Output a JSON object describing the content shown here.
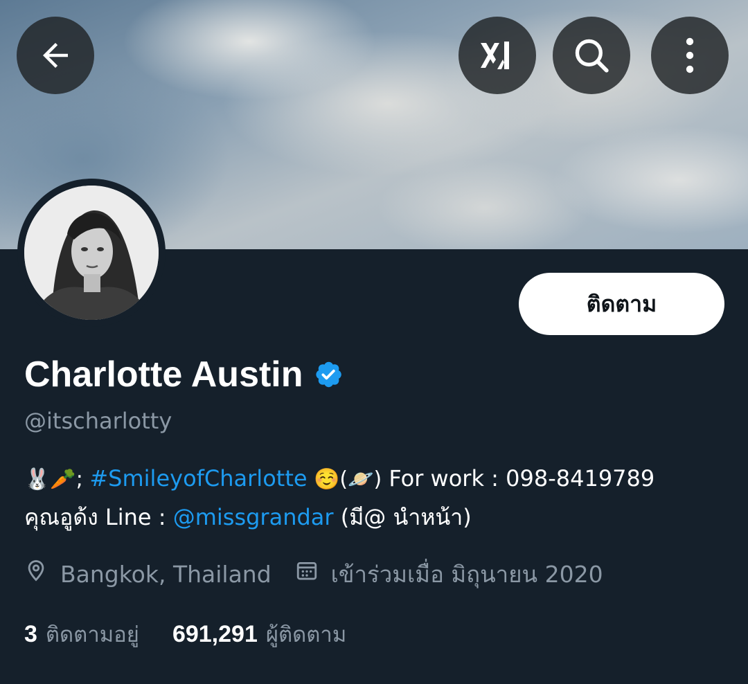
{
  "header": {
    "back_icon": "back-arrow-icon",
    "grok_icon": "grok-logo-icon",
    "search_icon": "search-icon",
    "more_icon": "more-vertical-icon"
  },
  "profile": {
    "display_name": "Charlotte Austin",
    "verified": true,
    "verified_color": "#1d9bf0",
    "handle": "@itscharlotty",
    "follow_label": "ติดตาม",
    "bio": {
      "line1_prefix": "🐰🥕; ",
      "hashtag": "#SmileyofCharlotte",
      "line1_suffix_emoji": " ☺️(🪐)",
      "line1_suffix_text": " For work : 098-8419789",
      "line2_prefix": "คุณอูด้ง Line : ",
      "mention": "@missgrandar",
      "line2_suffix": " (มี@ นำหน้า)"
    },
    "location": "Bangkok, Thailand",
    "joined": "เข้าร่วมเมื่อ มิถุนายน 2020",
    "following_count": "3",
    "following_label": "ติดตามอยู่",
    "followers_count": "691,291",
    "followers_label": "ผู้ติดตาม"
  },
  "colors": {
    "background": "#15202b",
    "accent_link": "#1d9bf0",
    "secondary_text": "#8b98a5"
  }
}
